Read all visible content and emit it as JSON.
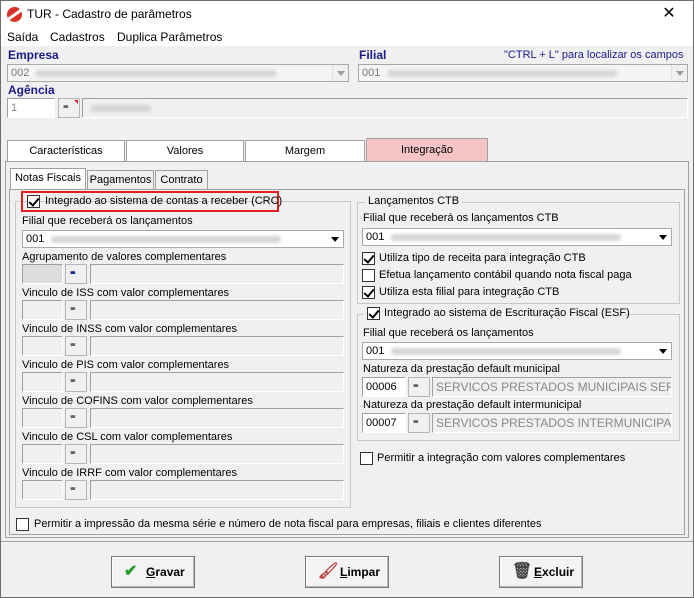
{
  "window": {
    "title": "TUR - Cadastro de parâmetros",
    "close_glyph": "✕"
  },
  "menu": [
    {
      "label": "Saída"
    },
    {
      "label": "Cadastros"
    },
    {
      "label": "Duplica Parâmetros"
    }
  ],
  "header": {
    "empresa_label": "Empresa",
    "empresa_code": "002",
    "filial_label": "Filial",
    "filial_code": "001",
    "hint": "\"CTRL + L\" para localizar os campos",
    "agencia_label": "Agência",
    "agencia_code": "1"
  },
  "tabs": [
    {
      "label": "Características",
      "active": false
    },
    {
      "label": "Valores",
      "active": false
    },
    {
      "label": "Margem",
      "active": false
    },
    {
      "label": "Integração",
      "active": true
    }
  ],
  "subtabs": [
    {
      "label": "Notas Fiscais",
      "active": true
    },
    {
      "label": "Pagamentos",
      "active": false
    },
    {
      "label": "Contrato",
      "active": false
    }
  ],
  "left": {
    "crc_label": "Integrado ao sistema de contas a receber (CRC)",
    "crc_checked": true,
    "filial_lanc_label": "Filial que receberá os lançamentos",
    "filial_lanc_code": "001",
    "agrupamento_label": "Agrupamento de valores complementares",
    "vinculos": [
      {
        "label": "Vinculo de ISS com valor complementares"
      },
      {
        "label": "Vinculo de INSS com valor complementares"
      },
      {
        "label": "Vinculo de PIS com valor complementares"
      },
      {
        "label": "Vinculo de COFINS com valor complementares"
      },
      {
        "label": "Vinculo de CSL com valor complementares"
      },
      {
        "label": "Vinculo de IRRF com valor complementares"
      }
    ]
  },
  "ctb": {
    "group_title": "Lançamentos CTB",
    "filial_label": "Filial que receberá os lançamentos CTB",
    "filial_code": "001",
    "options": [
      {
        "label": "Utiliza tipo de receita para integração CTB",
        "checked": true
      },
      {
        "label": "Efetua lançamento contábil quando nota fiscal paga",
        "checked": false
      },
      {
        "label": "Utiliza esta filial para integração CTB",
        "checked": true
      }
    ]
  },
  "esf": {
    "group_title": "Integrado ao sistema de Escrituração Fiscal (ESF)",
    "checked": true,
    "filial_label": "Filial que receberá os lançamentos",
    "filial_code": "001",
    "municipal_label": "Natureza da prestação default municipal",
    "municipal_code": "00006",
    "municipal_desc": "SERVICOS PRESTADOS MUNICIPAIS SERIE A",
    "intermunicipal_label": "Natureza da prestação default intermunicipal",
    "intermunicipal_code": "00007",
    "intermunicipal_desc": "SERVICOS PRESTADOS INTERMUNICIPAIS SE"
  },
  "complementares": {
    "label": "Permitir a integração com valores complementares",
    "checked": false
  },
  "impressao": {
    "label": "Permitir a impressão da mesma série e número de nota fiscal para empresas, filiais e clientes diferentes",
    "checked": false
  },
  "buttons": {
    "gravar": {
      "first": "G",
      "rest": "ravar",
      "icon": "✔"
    },
    "limpar": {
      "first": "L",
      "rest": "impar",
      "icon": "🖌"
    },
    "excluir": {
      "first": "E",
      "rest": "xcluir",
      "icon": "🗑"
    }
  },
  "colors": {
    "accent_tab": "#f5c5c5",
    "label_blue": "#1b1b8c",
    "highlight_red": "#e02020"
  }
}
